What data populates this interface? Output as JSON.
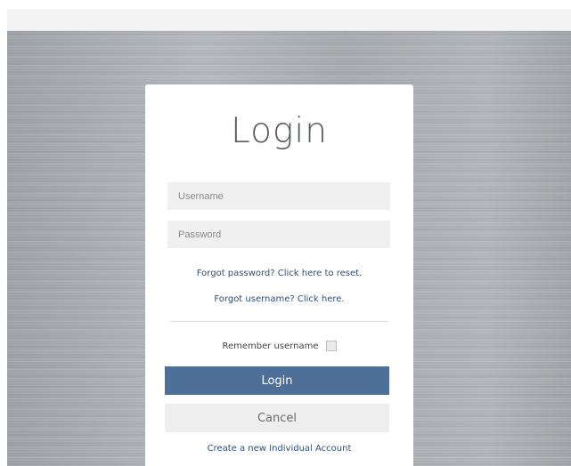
{
  "login": {
    "title": "Login",
    "username_placeholder": "Username",
    "password_placeholder": "Password",
    "forgot_password_link": "Forgot password? Click here to reset.",
    "forgot_username_link": "Forgot username? Click here.",
    "remember_label": "Remember username",
    "remember_checked": false,
    "login_button": "Login",
    "cancel_button": "Cancel",
    "create_account_link": "Create a new Individual Account"
  },
  "colors": {
    "primary_button": "#4e7098",
    "link": "#2e4f7c",
    "field_background": "#f0f0f0",
    "backdrop": "#a9adb1"
  }
}
